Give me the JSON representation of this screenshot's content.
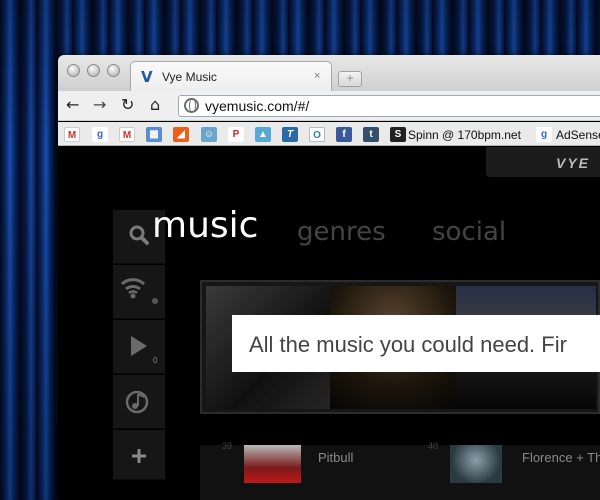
{
  "window": {
    "tab_title": "Vye Music",
    "tab_close": "×",
    "new_tab": "+",
    "url": "vyemusic.com/#/"
  },
  "bookmarks": [
    {
      "icon": "gmail-icon",
      "label": ""
    },
    {
      "icon": "google-icon",
      "label": ""
    },
    {
      "icon": "gmail-icon",
      "label": ""
    },
    {
      "icon": "calendar-icon",
      "label": ""
    },
    {
      "icon": "rss-icon",
      "label": ""
    },
    {
      "icon": "avatar-icon",
      "label": ""
    },
    {
      "icon": "pinterest-icon",
      "label": ""
    },
    {
      "icon": "picture-icon",
      "label": ""
    },
    {
      "icon": "t-icon",
      "label": ""
    },
    {
      "icon": "circle-icon",
      "label": ""
    },
    {
      "icon": "facebook-icon",
      "label": ""
    },
    {
      "icon": "tumblr-icon",
      "label": ""
    },
    {
      "icon": "s-icon",
      "label": "Spinn @ 170bpm.net"
    },
    {
      "icon": "google-icon",
      "label": "AdSense"
    }
  ],
  "page": {
    "logo": "VYE",
    "nav": {
      "music": "music",
      "genres": "genres",
      "social": "social"
    },
    "sidebar": {
      "play_count": "0"
    },
    "tagline": "All the music you could need. Fir",
    "songs": [
      {
        "number": "39",
        "artist": "Pitbull"
      },
      {
        "number": "40",
        "artist": "Florence + Th"
      }
    ]
  },
  "colors": {
    "accent": "#1a4fb0",
    "page_bg": "#000000",
    "nav_active": "#ffffff",
    "nav_inactive": "#444444"
  }
}
